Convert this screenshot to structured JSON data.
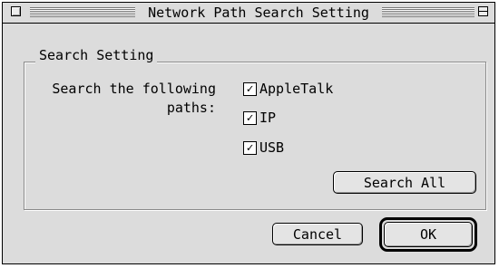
{
  "window": {
    "title": "Network Path Search Setting",
    "close_icon": "close-box-icon",
    "zoom_icon": "zoom-box-icon"
  },
  "group": {
    "title": "Search Setting",
    "prompt_line1": "Search the following",
    "prompt_line2": "paths:",
    "paths": [
      {
        "label": "AppleTalk",
        "checked": true
      },
      {
        "label": "IP",
        "checked": true
      },
      {
        "label": "USB",
        "checked": true
      }
    ],
    "search_all_label": "Search All"
  },
  "buttons": {
    "cancel_label": "Cancel",
    "ok_label": "OK"
  }
}
